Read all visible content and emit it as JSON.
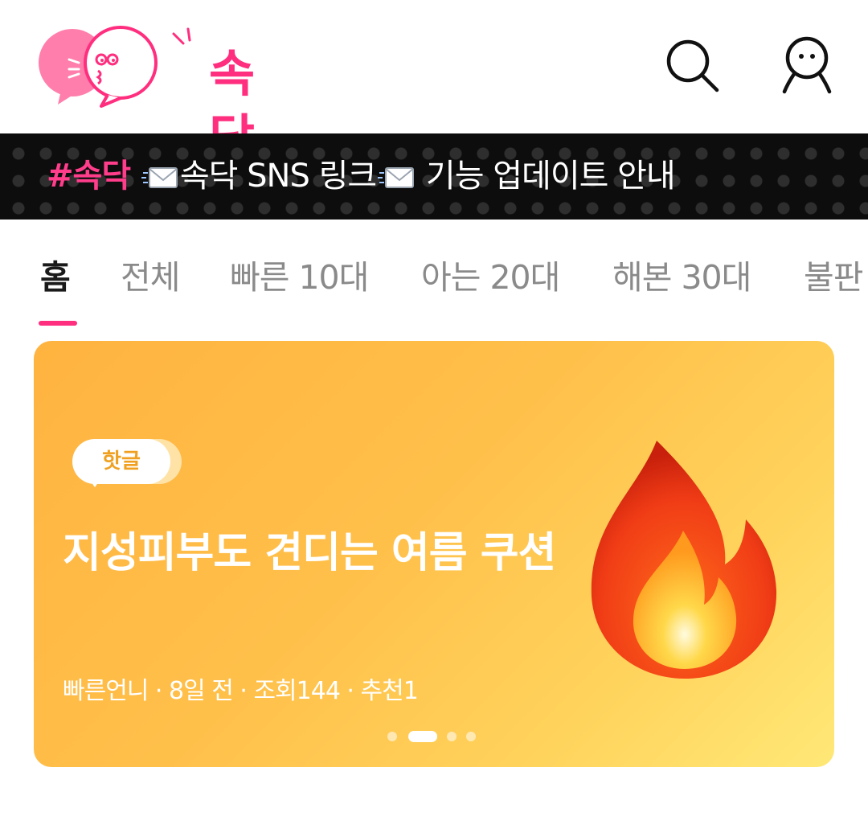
{
  "header": {
    "logo_text": "속닥",
    "search_icon": "search-icon",
    "profile_icon": "profile-icon"
  },
  "notice": {
    "tag": "#속닥",
    "part1": "속닥 SNS 링크",
    "part2": " 기능 업데이트 안내",
    "icon": "envelope-icon"
  },
  "tabs": [
    {
      "label": "홈",
      "active": true
    },
    {
      "label": "전체"
    },
    {
      "label": "빠른 10대"
    },
    {
      "label": "아는 20대"
    },
    {
      "label": "해본 30대"
    },
    {
      "label": "불판"
    }
  ],
  "featured": {
    "badge": "핫글",
    "title": "지성피부도 견디는 여름 쿠션",
    "meta": "빠른언니 · 8일 전 · 조회144 · 추천1",
    "icon": "fire-icon",
    "pagination": {
      "count": 4,
      "active_index": 1
    }
  },
  "colors": {
    "brand": "#ff2e7e",
    "card_gradient_start": "#ffb340",
    "card_gradient_end": "#ffe877"
  }
}
